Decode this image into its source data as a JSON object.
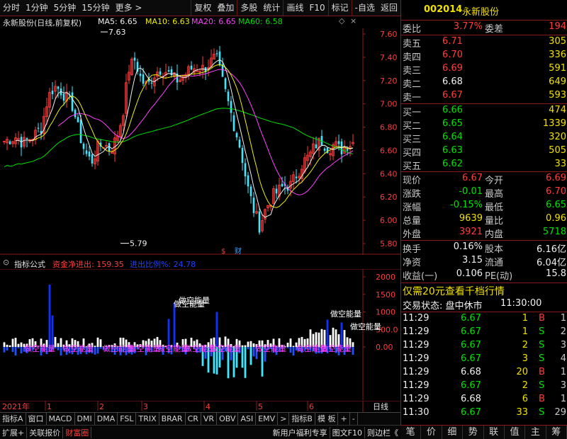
{
  "toolbar": {
    "items": [
      "分时",
      "1分钟",
      "5分钟",
      "15分钟",
      "更多 >",
      "复权",
      "叠加",
      "多股",
      "统计",
      "画线",
      "F10",
      "标记",
      "-自选",
      "返回"
    ]
  },
  "chart_header": {
    "stock_label": "永新股份(日线,前复权)",
    "ma5": "MA5: 6.65",
    "ma10": "MA10: 6.63",
    "ma20": "MA20: 6.65",
    "ma60": "MA60: 6.58"
  },
  "colors": {
    "ma5": "#f0f0f0",
    "ma10": "#f0f000",
    "ma20": "#ff40ff",
    "ma60": "#00e000",
    "up": "#ff3c3c",
    "down": "#40e8ff",
    "grid": "#8a1a1a"
  },
  "price_axis": [
    "7.60",
    "7.40",
    "7.20",
    "7.00",
    "6.80",
    "6.60",
    "6.40",
    "6.20",
    "6.00",
    "5.80"
  ],
  "annotations": {
    "high": "7.63",
    "low": "5.79",
    "marker": "$",
    "cai": "财"
  },
  "sub_header": {
    "name": "指标公式",
    "item1": "资金净进出: 159.35",
    "item2": "进出比例%: 24.78"
  },
  "sub_axis": [
    "2000",
    "1500",
    "1000",
    "500.0",
    "0.00"
  ],
  "sub_labels": {
    "short_energy": "做空能量"
  },
  "date_axis": {
    "year": "2021年",
    "months": [
      "1",
      "2",
      "3",
      "4",
      "5",
      "6"
    ],
    "right": "日线"
  },
  "indicator_tabs": [
    "指标A",
    "窗口",
    "MACD",
    "DMI",
    "DMA",
    "FSL",
    "TRIX",
    "BRAR",
    "CR",
    "VR",
    "OBV",
    "ASI",
    "EMV",
    ">",
    "指标B",
    "模 板",
    "+",
    "-"
  ],
  "statusbar": {
    "left": [
      "扩展+",
      "关联报价",
      "财富圈"
    ],
    "right": [
      "新用户福利专享",
      "图文F10",
      "则边栏《"
    ]
  },
  "quote": {
    "code": "002014",
    "name": "永新股份",
    "weibi_label": "委比",
    "weibi": "3.77%",
    "weicha_label": "委差",
    "weicha": "194",
    "sells": [
      {
        "label": "卖五",
        "price": "6.71",
        "vol": "305"
      },
      {
        "label": "卖四",
        "price": "6.70",
        "vol": "336"
      },
      {
        "label": "卖三",
        "price": "6.69",
        "vol": "591"
      },
      {
        "label": "卖二",
        "price": "6.68",
        "vol": "649"
      },
      {
        "label": "卖一",
        "price": "6.67",
        "vol": "593"
      }
    ],
    "buys": [
      {
        "label": "买一",
        "price": "6.66",
        "vol": "474"
      },
      {
        "label": "买二",
        "price": "6.65",
        "vol": "1339"
      },
      {
        "label": "买三",
        "price": "6.64",
        "vol": "320"
      },
      {
        "label": "买四",
        "price": "6.63",
        "vol": "505"
      },
      {
        "label": "买五",
        "price": "6.62",
        "vol": "33"
      }
    ],
    "stats": [
      {
        "l1": "现价",
        "v1": "6.67",
        "l2": "今开",
        "v2": "6.69"
      },
      {
        "l1": "涨跌",
        "v1": "-0.01",
        "l2": "最高",
        "v2": "6.70"
      },
      {
        "l1": "涨幅",
        "v1": "-0.15%",
        "l2": "最低",
        "v2": "6.65"
      },
      {
        "l1": "总量",
        "v1": "9639",
        "l2": "量比",
        "v2": "0.96"
      },
      {
        "l1": "外盘",
        "v1": "3921",
        "l2": "内盘",
        "v2": "5718"
      }
    ],
    "stats2": [
      {
        "l1": "换手",
        "v1": "0.16%",
        "l2": "股本",
        "v2": "6.16亿"
      },
      {
        "l1": "净资",
        "v1": "3.15",
        "l2": "流通",
        "v2": "6.04亿"
      },
      {
        "l1": "收益(一)",
        "v1": "0.106",
        "l2": "PE(动)",
        "v2": "15.8"
      }
    ],
    "promo": "仅需20元查看千档行情",
    "trade_status_label": "交易状态: 盘中休市",
    "trade_status_time": "11:30:00",
    "ticks": [
      {
        "t": "11:29",
        "p": "6.67",
        "v": "1",
        "bs": "B",
        "n": "1"
      },
      {
        "t": "11:29",
        "p": "6.67",
        "v": "1",
        "bs": "S",
        "n": "2"
      },
      {
        "t": "11:29",
        "p": "6.67",
        "v": "2",
        "bs": "S",
        "n": "3"
      },
      {
        "t": "11:29",
        "p": "6.67",
        "v": "3",
        "bs": "S",
        "n": "4"
      },
      {
        "t": "11:29",
        "p": "6.68",
        "v": "20",
        "bs": "B",
        "n": "1"
      },
      {
        "t": "11:29",
        "p": "6.67",
        "v": "2",
        "bs": "S",
        "n": "3"
      },
      {
        "t": "11:29",
        "p": "6.68",
        "v": "6",
        "bs": "B",
        "n": "1"
      },
      {
        "t": "11:30",
        "p": "6.67",
        "v": "33",
        "bs": "S",
        "n": "29"
      }
    ],
    "bottom_tabs": [
      "笔",
      "价",
      "细",
      "势",
      "联",
      "值",
      "主",
      "筹"
    ]
  }
}
